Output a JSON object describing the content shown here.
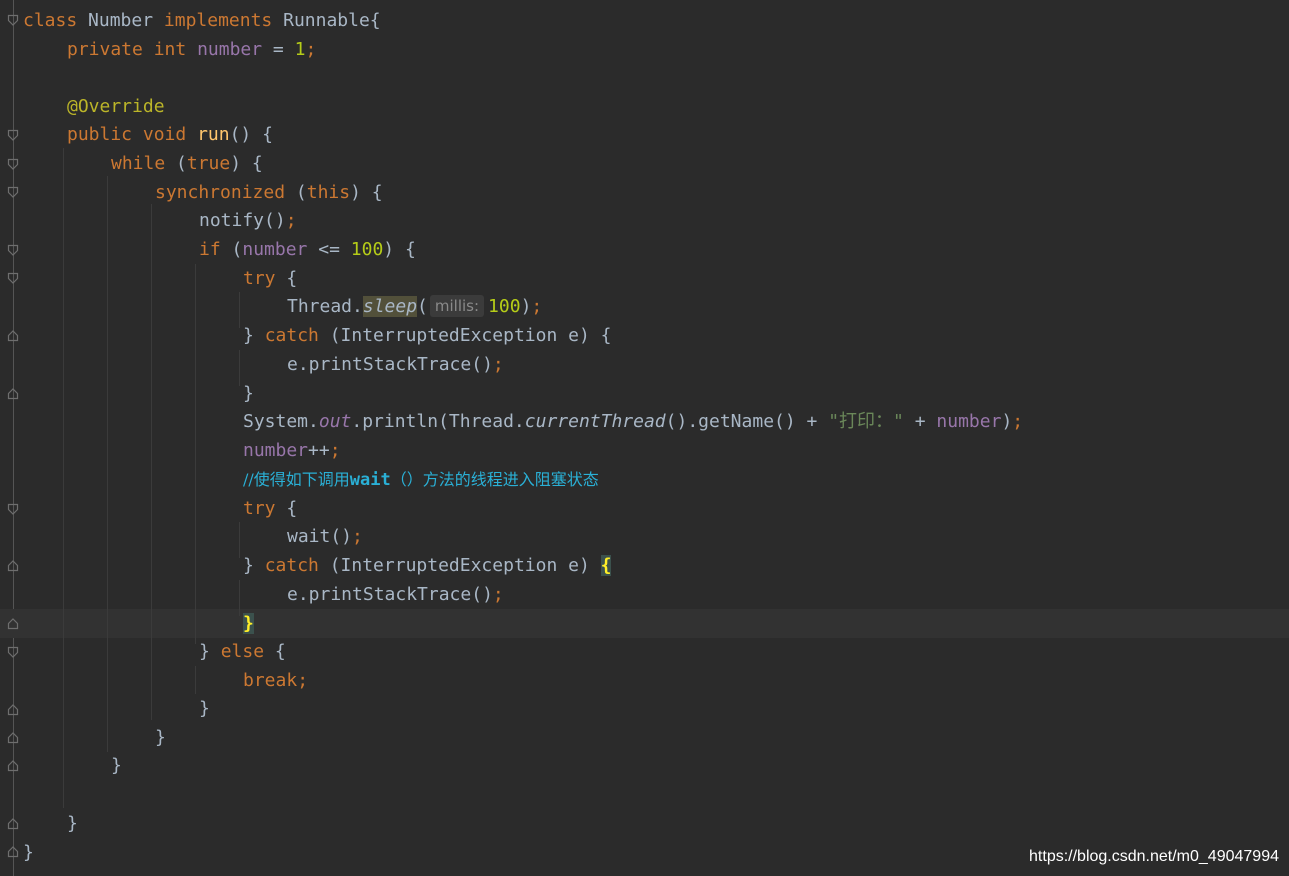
{
  "code": {
    "l1": {
      "kw1": "class",
      "t1": " Number ",
      "kw2": "implements",
      "t2": " Runnable{"
    },
    "l2": {
      "kw1": "private",
      "kw2": "int",
      "fld": "number",
      "t1": " = ",
      "num": "1",
      "sem": ";"
    },
    "l3": {
      "ann": "@Override"
    },
    "l4": {
      "kw1": "public",
      "kw2": "void",
      "fn": "run",
      "t1": "() {"
    },
    "l5": {
      "kw1": "while",
      "t1": " (",
      "kw2": "true",
      "t2": ") {"
    },
    "l6": {
      "kw1": "synchronized",
      "t1": " (",
      "kw2": "this",
      "t2": ") {"
    },
    "l7": {
      "t1": "notify()",
      "sem": ";"
    },
    "l8": {
      "kw1": "if",
      "t1": " (",
      "fld": "number",
      "t2": " <= ",
      "num": "100",
      "t3": ") {"
    },
    "l9": {
      "kw1": "try",
      "t1": " {"
    },
    "l10": {
      "t1": "Thread.",
      "m": "sleep",
      "t2": "(",
      "hint": "millis:",
      "num": "100",
      "t3": ")",
      "sem": ";"
    },
    "l11": {
      "t1": "} ",
      "kw1": "catch",
      "t2": " (InterruptedException e) {"
    },
    "l12": {
      "t1": "e.printStackTrace()",
      "sem": ";"
    },
    "l13": {
      "t1": "}"
    },
    "l14": {
      "t1": "System.",
      "f": "out",
      "t2": ".println(Thread.",
      "m": "currentThread",
      "t3": "().getName() + ",
      "s": "\"打印：\"",
      "t4": " + ",
      "fld": "number",
      "t5": ")",
      "sem": ";"
    },
    "l15": {
      "fld": "number",
      "t1": "++",
      "sem": ";"
    },
    "l16": {
      "c1": "//使得如下调用",
      "c2": "wait",
      "c3": "（）方法的线程进入阻塞状态"
    },
    "l17": {
      "kw1": "try",
      "t1": " {"
    },
    "l18": {
      "t1": "wait()",
      "sem": ";"
    },
    "l19": {
      "t1": "} ",
      "kw1": "catch",
      "t2": " (InterruptedException e) ",
      "b": "{"
    },
    "l20": {
      "t1": "e.printStackTrace()",
      "sem": ";"
    },
    "l21": {
      "b": "}"
    },
    "l22": {
      "t1": "} ",
      "kw1": "else",
      "t2": " {"
    },
    "l23": {
      "kw1": "break",
      "sem": ";"
    },
    "l24": {
      "t1": "}"
    },
    "l25": {
      "t1": "}"
    },
    "l26": {
      "t1": "}"
    },
    "l27": {
      "t1": "}"
    },
    "l28": {
      "t1": "}"
    }
  },
  "watermark": "https://blog.csdn.net/m0_49047994",
  "theme": {
    "keyword": "#cc7832",
    "plain": "#a9b7c6",
    "field": "#9876aa",
    "number": "#b5cc18",
    "annotation": "#bbb529",
    "method": "#ffc66d",
    "comment": "#2ab0d6",
    "background": "#2b2b2b"
  }
}
